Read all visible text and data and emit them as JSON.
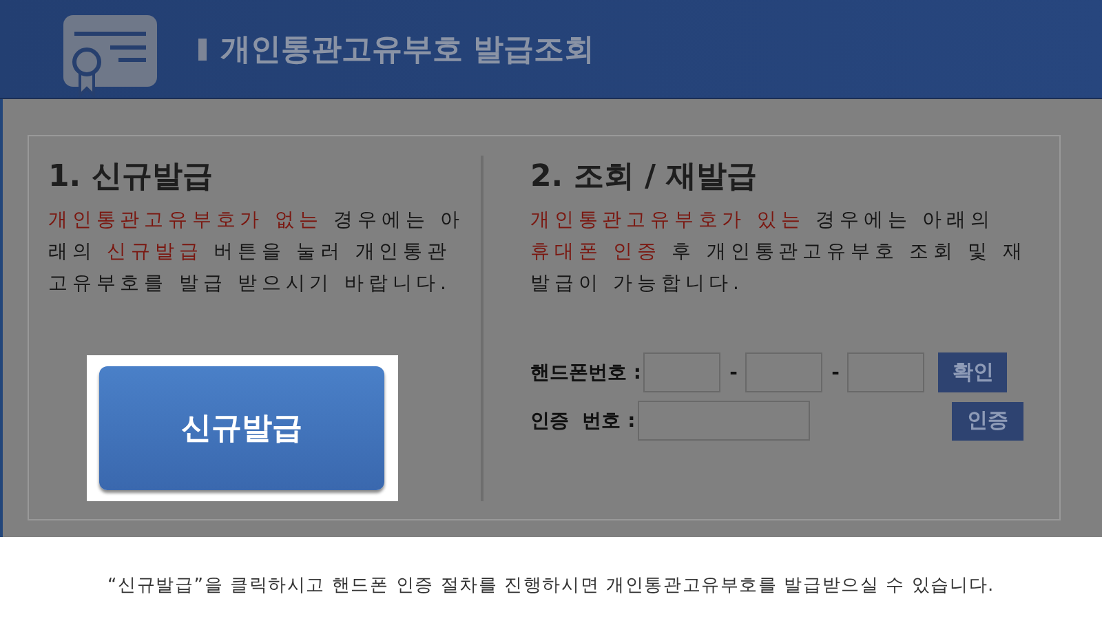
{
  "header": {
    "title": "개인통관고유부호 발급조회"
  },
  "sections": [
    {
      "heading": "1. 신규발급",
      "text": [
        {
          "text": "개인통관고유부호가 없는",
          "highlight": true
        },
        {
          "text": " 경우에는 아래의 ",
          "highlight": false
        },
        {
          "text": "신규발급",
          "highlight": true
        },
        {
          "text": " 버튼을 눌러 개인통관고유부호를 발급 받으시기 바랍니다.",
          "highlight": false
        }
      ],
      "button": "신규발급"
    },
    {
      "heading": "2. 조회 / 재발급",
      "text": [
        {
          "text": "개인통관고유부호가 있는",
          "highlight": true
        },
        {
          "text": " 경우에는 아래의 ",
          "highlight": false
        },
        {
          "text": "휴대폰 인증",
          "highlight": true
        },
        {
          "text": " 후 개인통관고유부호 조회 및 재발급이 가능합니다.",
          "highlight": false
        }
      ],
      "phone_label": "핸드폰번호 :",
      "separators": [
        "-",
        "-"
      ],
      "confirm_button": "확인",
      "auth_label": "인증  번호 :",
      "auth_button": "인증"
    }
  ],
  "caption": "“신규발급”을 클릭하시고 핸드폰 인증 절차를 진행하시면 개인통관고유부호를 발급받으실 수 있습니다."
}
